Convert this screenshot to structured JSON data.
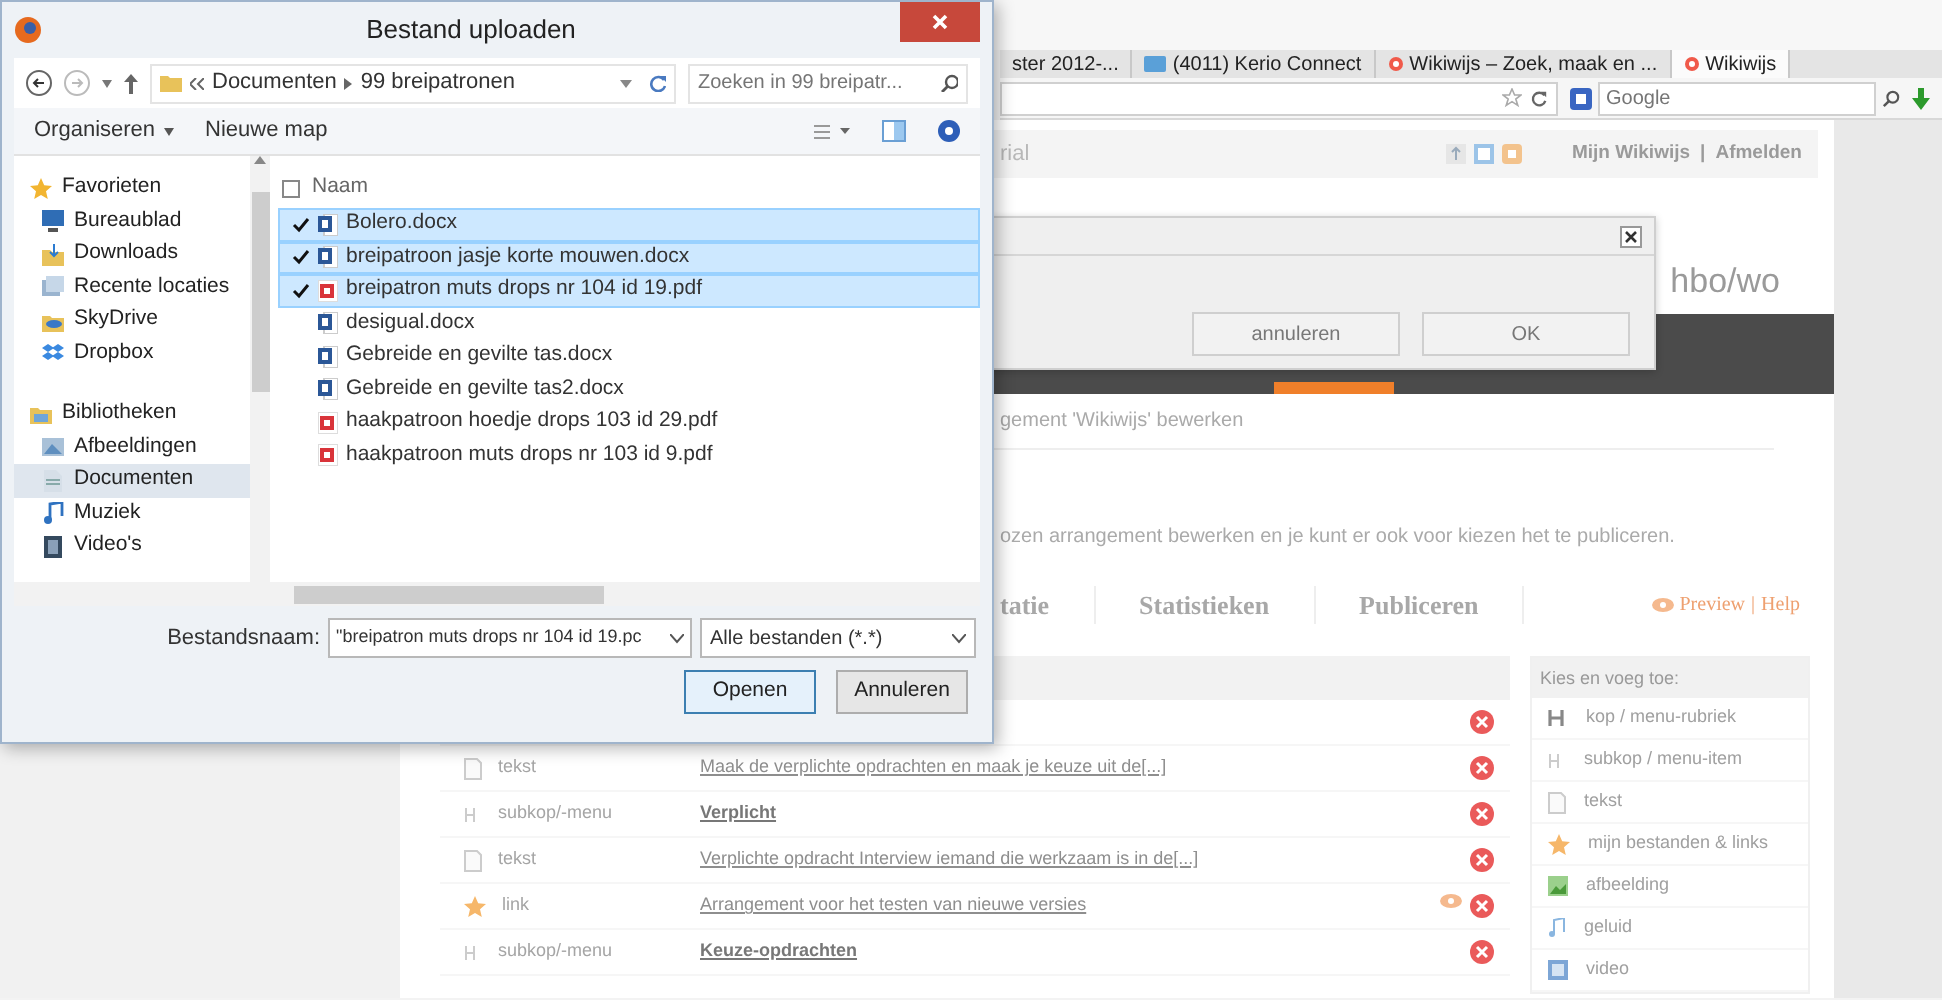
{
  "file_dialog": {
    "title": "Bestand uploaden",
    "breadcrumb": [
      "Documenten",
      "99 breipatronen"
    ],
    "search": {
      "placeholder": "Zoeken in 99 breipatr..."
    },
    "toolbar": [
      "Organiseren",
      "Nieuwe map"
    ],
    "nav": [
      {
        "label": "Favorieten",
        "kind": "star",
        "children": [
          {
            "label": "Bureaublad",
            "kind": "desktop",
            "selected": false
          },
          {
            "label": "Downloads",
            "kind": "download",
            "selected": false
          },
          {
            "label": "Recente locaties",
            "kind": "recent",
            "selected": false
          },
          {
            "label": "SkyDrive",
            "kind": "cloud",
            "selected": false
          },
          {
            "label": "Dropbox",
            "kind": "box",
            "selected": false
          }
        ]
      },
      {
        "label": "Bibliotheken",
        "kind": "library",
        "children": [
          {
            "label": "Afbeeldingen",
            "kind": "pictures",
            "selected": false
          },
          {
            "label": "Documenten",
            "kind": "documents",
            "selected": true
          },
          {
            "label": "Muziek",
            "kind": "music",
            "selected": false
          },
          {
            "label": "Video's",
            "kind": "video",
            "selected": false
          }
        ]
      }
    ],
    "column_header": "Naam",
    "files": [
      {
        "name": "Bolero.docx",
        "kind": "docx",
        "checked": true,
        "selected": true
      },
      {
        "name": "breipatroon jasje korte mouwen.docx",
        "kind": "docx",
        "checked": true,
        "selected": true
      },
      {
        "name": "breipatron muts drops nr 104 id 19.pdf",
        "kind": "pdf",
        "checked": true,
        "selected": true
      },
      {
        "name": "desigual.docx",
        "kind": "docx",
        "checked": false,
        "selected": false
      },
      {
        "name": "Gebreide en gevilte tas.docx",
        "kind": "docx",
        "checked": false,
        "selected": false
      },
      {
        "name": "Gebreide en gevilte tas2.docx",
        "kind": "docx",
        "checked": false,
        "selected": false
      },
      {
        "name": "haakpatroon hoedje drops 103 id 29.pdf",
        "kind": "pdf",
        "checked": false,
        "selected": false
      },
      {
        "name": "haakpatroon muts drops nr 103 id 9.pdf",
        "kind": "pdf",
        "checked": false,
        "selected": false
      }
    ],
    "filename_label": "Bestandsnaam:",
    "filename": "\"breipatron muts drops nr 104 id 19.pc",
    "filetype": "Alle bestanden (*.*)",
    "buttons": [
      "Openen",
      "Annuleren"
    ]
  },
  "browser": {
    "tabs": [
      {
        "label": "ster 2012-...",
        "kind": "plain",
        "selected": false
      },
      {
        "label": "(4011) Kerio Connect",
        "kind": "mail",
        "selected": false
      },
      {
        "label": "Wikiwijs – Zoek, maak en ...",
        "kind": "site",
        "selected": false
      },
      {
        "label": "Wikiwijs",
        "kind": "site",
        "selected": true
      }
    ],
    "search_engine": {
      "placeholder": "Google"
    }
  },
  "page": {
    "header_text": "rial",
    "user_links": [
      "Mijn Wikiwijs",
      "Afmelden"
    ],
    "link_separator": "|",
    "level": "hbo/wo",
    "breadcrumb_title": "gement 'Wikiwijs' bewerken",
    "intro": "ozen arrangement bewerken en je kunt er ook voor kiezen het te publiceren.",
    "tabs": [
      "tatie",
      "Statistieken",
      "Publiceren"
    ],
    "preview_link": "Preview",
    "help_link": "Help",
    "rows": [
      {
        "kind": "covered"
      },
      {
        "kind": "text",
        "type": "tekst",
        "title": "Maak de verplichte opdrachten en maak je keuze uit de[...]",
        "preview": false
      },
      {
        "kind": "subheading",
        "type": "subkop/-menu",
        "title": "Verplicht",
        "preview": false
      },
      {
        "kind": "text",
        "type": "tekst",
        "title": "Verplichte opdracht Interview iemand die werkzaam is in de[...]",
        "preview": false
      },
      {
        "kind": "link",
        "type": "link",
        "title": "Arrangement voor het testen van nieuwe versies",
        "preview": true
      },
      {
        "kind": "subheading",
        "type": "subkop/-menu",
        "title": "Keuze-opdrachten",
        "preview": false
      }
    ],
    "sidebar": {
      "title": "Kies en voeg toe:",
      "items": [
        {
          "label": "kop / menu-rubriek",
          "kind": "heading"
        },
        {
          "label": "subkop / menu-item",
          "kind": "subheading"
        },
        {
          "label": "tekst",
          "kind": "text"
        },
        {
          "label": "mijn bestanden & links",
          "kind": "link"
        },
        {
          "label": "afbeelding",
          "kind": "image"
        },
        {
          "label": "geluid",
          "kind": "sound"
        },
        {
          "label": "video",
          "kind": "video"
        }
      ]
    }
  },
  "modal": {
    "buttons": [
      "annuleren",
      "OK"
    ]
  }
}
